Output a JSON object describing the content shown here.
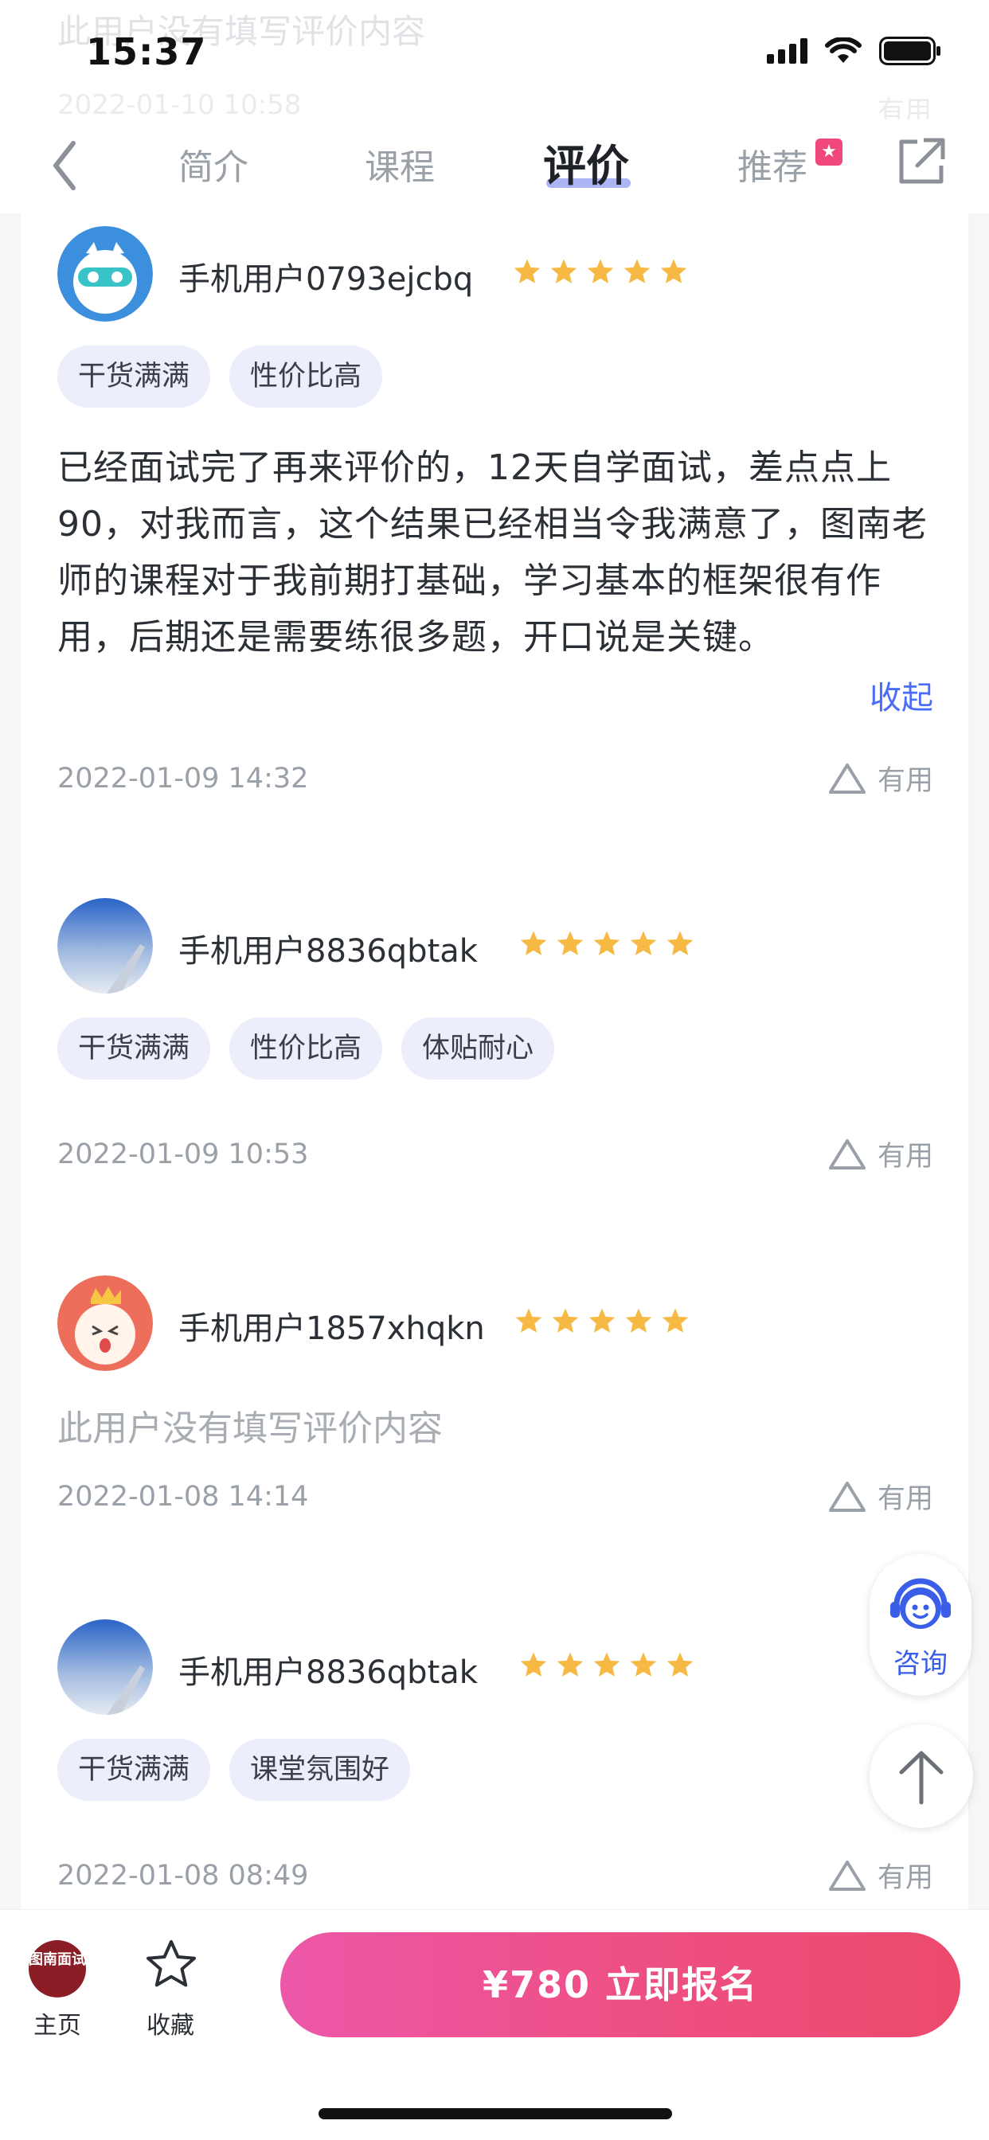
{
  "status_bar": {
    "time": "15:37"
  },
  "ghost_review": {
    "text": "此用户没有填写评价内容",
    "date": "2022-01-10 10:58",
    "useful": "有用"
  },
  "nav": {
    "tabs": [
      {
        "label": "简介"
      },
      {
        "label": "课程"
      },
      {
        "label": "评价",
        "active": true
      },
      {
        "label": "推荐"
      }
    ]
  },
  "reviews": [
    {
      "user": "手机用户0793ejcbq",
      "rating": 5,
      "tags": [
        "干货满满",
        "性价比高"
      ],
      "text": "已经面试完了再来评价的，12天自学面试，差点点上90，对我而言，这个结果已经相当令我满意了，图南老师的课程对于我前期打基础，学习基本的框架很有作用，后期还是需要练很多题，开口说是关键。",
      "collapse_label": "收起",
      "date": "2022-01-09 14:32",
      "useful": "有用"
    },
    {
      "user": "手机用户8836qbtak",
      "rating": 5,
      "tags": [
        "干货满满",
        "性价比高",
        "体贴耐心"
      ],
      "date": "2022-01-09 10:53",
      "useful": "有用"
    },
    {
      "user": "手机用户1857xhqkn",
      "rating": 5,
      "empty_text": "此用户没有填写评价内容",
      "date": "2022-01-08 14:14",
      "useful": "有用"
    },
    {
      "user": "手机用户8836qbtak",
      "rating": 5,
      "tags": [
        "干货满满",
        "课堂氛围好"
      ],
      "date": "2022-01-08 08:49",
      "useful": "有用"
    }
  ],
  "floating": {
    "consult_label": "咨询"
  },
  "bottom_bar": {
    "home_logo": "图南面试",
    "home_label": "主页",
    "favorite_label": "收藏",
    "enroll_label": "¥780  立即报名"
  },
  "colors": {
    "accent": "#4a6cf7",
    "star": "#f5b944",
    "tag_bg": "#eceefb",
    "enroll_start": "#ec57a8",
    "enroll_end": "#ec4a6c",
    "badge": "#f0487a"
  }
}
